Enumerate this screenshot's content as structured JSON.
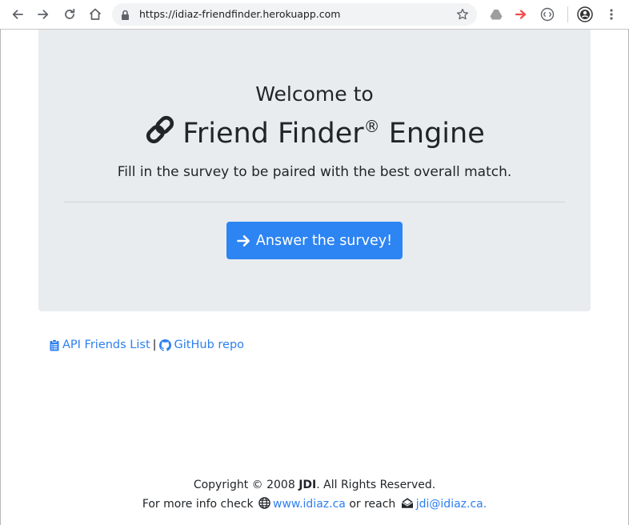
{
  "browser": {
    "url": "https://idiaz-friendfinder.herokuapp.com"
  },
  "hero": {
    "welcome": "Welcome to",
    "title": "Friend Finder",
    "registered_mark": "®",
    "title_suffix": "Engine",
    "lead": "Fill in the survey to be paired with the best overall match.",
    "button_label": "Answer the survey!"
  },
  "links": {
    "api_label": "API Friends List",
    "separator": "|",
    "github_label": "GitHub repo"
  },
  "footer": {
    "copyright_prefix": "Copyright © 2008",
    "brand": "JDI",
    "copyright_suffix": ". All Rights Reserved.",
    "info_prefix": "For more info check",
    "website": "www.idiaz.ca",
    "or_reach": "or reach",
    "email": "jdi@idiaz.ca."
  },
  "colors": {
    "jumbotron_bg": "#e9ecef",
    "primary": "#2d84f3",
    "link": "#2d7ff0"
  },
  "icons": {
    "back": "back-arrow-icon",
    "forward": "forward-arrow-icon",
    "reload": "reload-icon",
    "home": "home-icon",
    "lock": "lock-icon",
    "bookmark": "star-icon",
    "title": "link-icon",
    "button": "arrow-right-icon",
    "api": "clipboard-list-icon",
    "github": "github-icon",
    "website": "globe-icon",
    "email": "envelope-open-icon"
  }
}
